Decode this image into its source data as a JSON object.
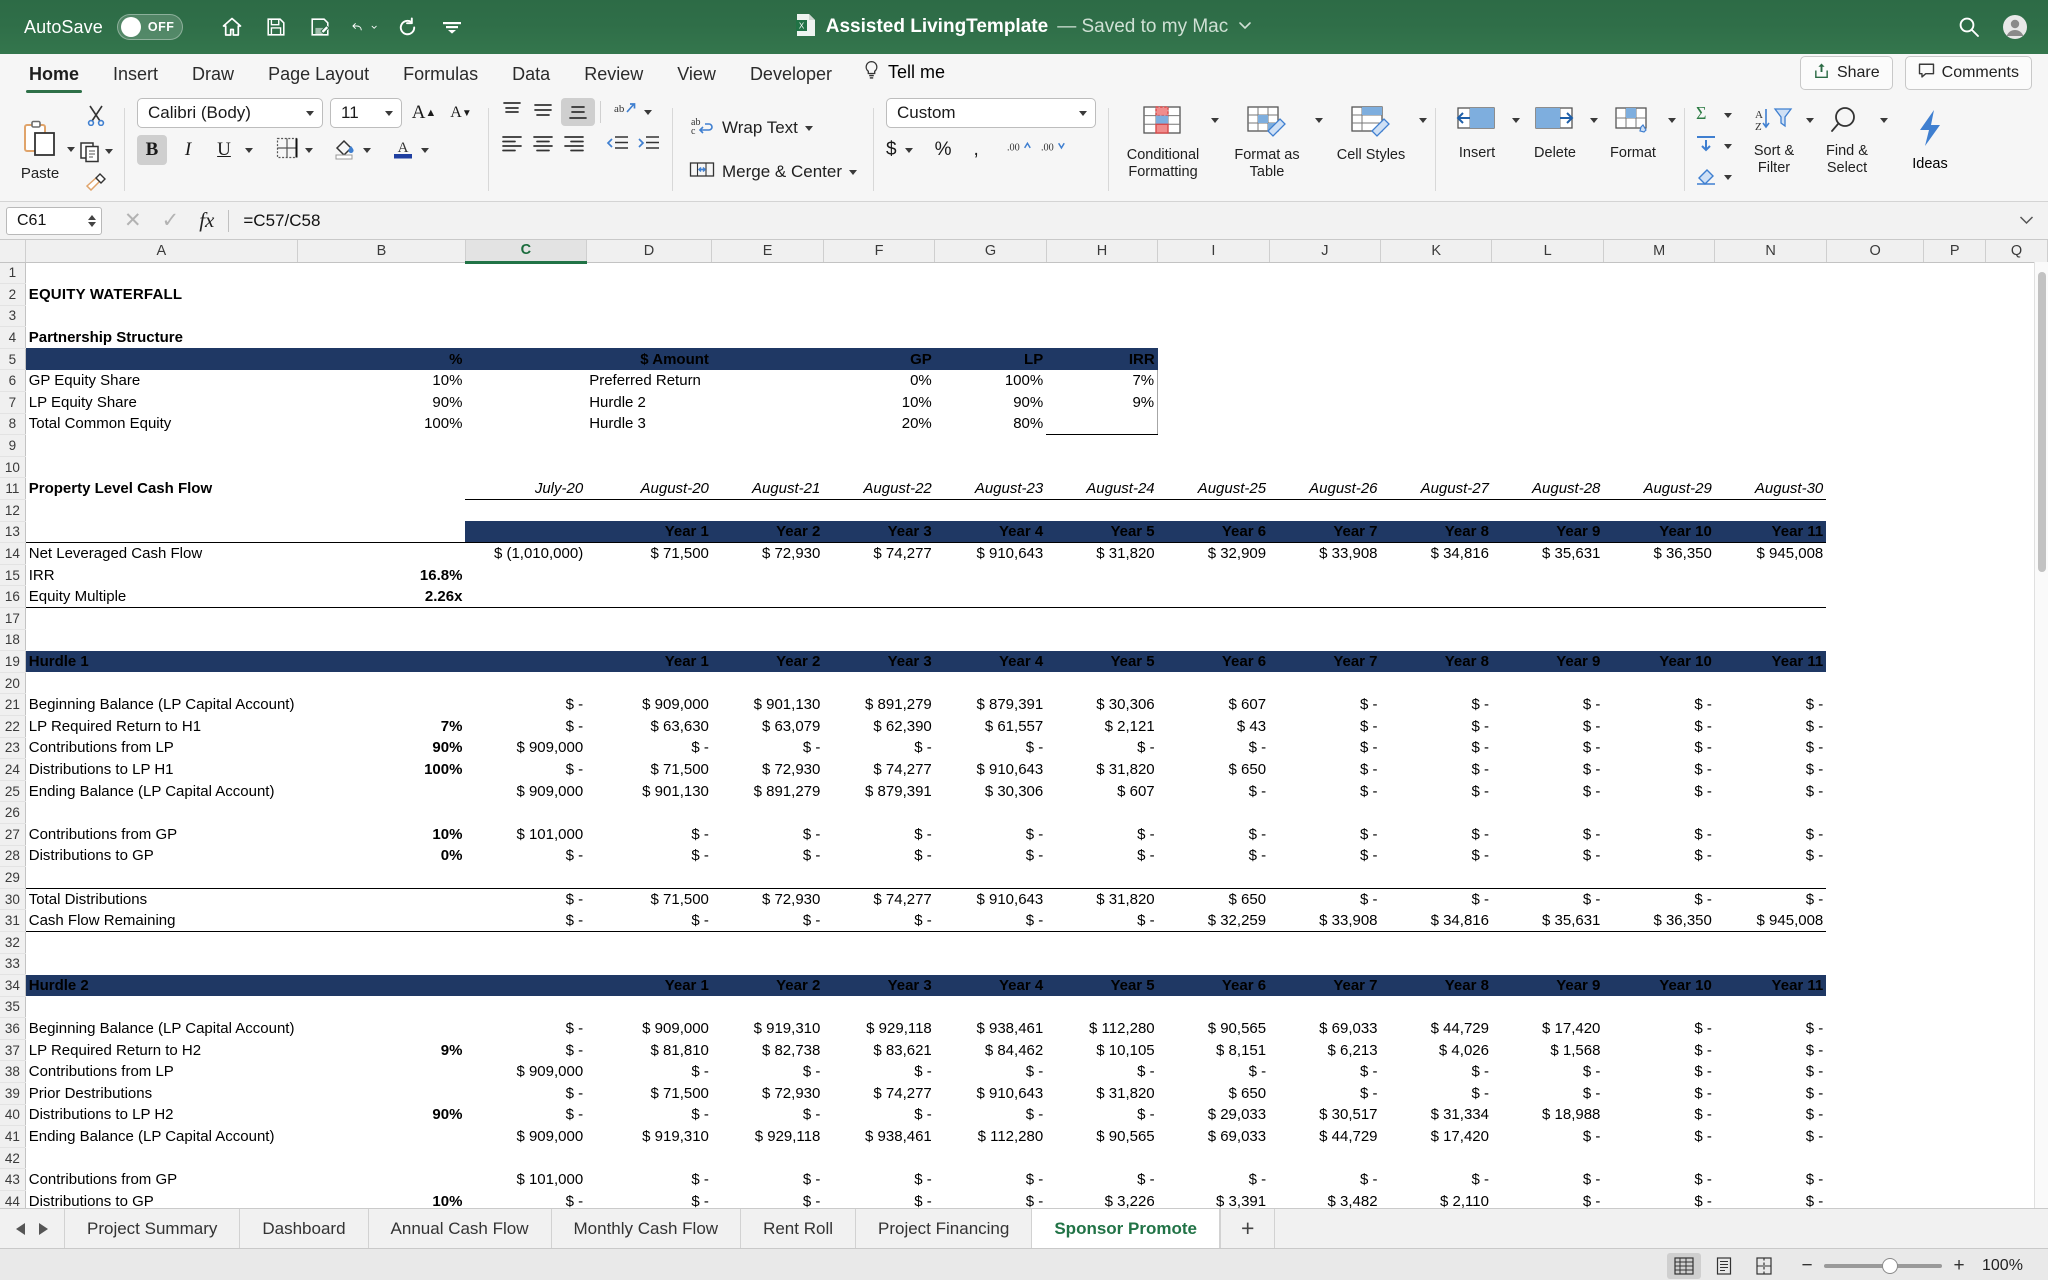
{
  "titlebar": {
    "autosave_label": "AutoSave",
    "autosave_state": "OFF",
    "doc_title": "Assisted LivingTemplate",
    "doc_status": "— Saved to my Mac",
    "icons": [
      "home-icon",
      "save-icon",
      "save-edit-icon",
      "undo-icon",
      "redo-icon",
      "customize-toolbar-icon",
      "search-icon",
      "account-icon"
    ]
  },
  "ribbon_tabs": {
    "tabs": [
      "Home",
      "Insert",
      "Draw",
      "Page Layout",
      "Formulas",
      "Data",
      "Review",
      "View",
      "Developer"
    ],
    "active": "Home",
    "tell_me": "Tell me",
    "share": "Share",
    "comments": "Comments"
  },
  "ribbon": {
    "paste_label": "Paste",
    "font_name": "Calibri (Body)",
    "font_size": "11",
    "number_format": "Custom",
    "wrap_text": "Wrap Text",
    "merge_center": "Merge & Center",
    "conditional_formatting": "Conditional Formatting",
    "format_as_table": "Format as Table",
    "cell_styles": "Cell Styles",
    "insert": "Insert",
    "delete": "Delete",
    "format": "Format",
    "sort_filter": "Sort & Filter",
    "find_select": "Find & Select",
    "ideas": "Ideas"
  },
  "formula_bar": {
    "name_box": "C61",
    "formula": "=C57/C58"
  },
  "grid": {
    "column_headers": [
      "A",
      "B",
      "C",
      "D",
      "E",
      "F",
      "G",
      "H",
      "I",
      "J",
      "K",
      "L",
      "M",
      "N",
      "O",
      "P",
      "Q"
    ],
    "selected_column": "C",
    "first_row": 1,
    "last_row": 44
  },
  "sheet_tabs": {
    "tabs": [
      "Project Summary",
      "Dashboard",
      "Annual Cash Flow",
      "Monthly Cash Flow",
      "Rent Roll",
      "Project Financing",
      "Sponsor Promote"
    ],
    "active": "Sponsor Promote",
    "add_label": "+"
  },
  "statusbar": {
    "zoom": "100%",
    "views": [
      "normal-view",
      "page-layout-view",
      "page-break-view"
    ]
  },
  "sheet": {
    "title": "EQUITY WATERFALL",
    "partnership": {
      "heading": "Partnership Structure",
      "headers": [
        "",
        "%",
        "$ Amount",
        "",
        "GP",
        "LP",
        "IRR"
      ],
      "rows": [
        {
          "label": "GP Equity Share",
          "pct": "10%",
          "amount": "",
          "name": "Preferred Return",
          "gp": "0%",
          "lp": "100%",
          "irr": "7%"
        },
        {
          "label": "LP Equity Share",
          "pct": "90%",
          "amount": "",
          "name": "Hurdle 2",
          "gp": "10%",
          "lp": "90%",
          "irr": "9%"
        },
        {
          "label": "Total Common Equity",
          "pct": "100%",
          "amount": "",
          "name": "Hurdle 3",
          "gp": "20%",
          "lp": "80%",
          "irr": ""
        }
      ]
    },
    "property_cf": {
      "heading": "Property Level Cash Flow",
      "dates": [
        "July-20",
        "August-20",
        "August-21",
        "August-22",
        "August-23",
        "August-24",
        "August-25",
        "August-26",
        "August-27",
        "August-28",
        "August-29",
        "August-30"
      ],
      "year_headers": [
        "Year 1",
        "Year 2",
        "Year 3",
        "Year 4",
        "Year 5",
        "Year 6",
        "Year 7",
        "Year 8",
        "Year 9",
        "Year 10",
        "Year 11"
      ],
      "net_leveraged_label": "Net Leveraged Cash Flow",
      "net_leveraged_initial": "(1,010,000)",
      "net_leveraged": [
        "71,500",
        "72,930",
        "74,277",
        "910,643",
        "31,820",
        "32,909",
        "33,908",
        "34,816",
        "35,631",
        "36,350",
        "945,008"
      ],
      "irr_label": "IRR",
      "irr_value": "16.8%",
      "equity_multiple_label": "Equity Multiple",
      "equity_multiple_value": "2.26x"
    },
    "hurdle1": {
      "title": "Hurdle 1",
      "year_headers": [
        "Year 1",
        "Year 2",
        "Year 3",
        "Year 4",
        "Year 5",
        "Year 6",
        "Year 7",
        "Year 8",
        "Year 9",
        "Year 10",
        "Year 11"
      ],
      "rows": [
        {
          "label": "Beginning Balance (LP Capital Account)",
          "pct": "",
          "initial": "-",
          "values": [
            "909,000",
            "901,130",
            "891,279",
            "879,391",
            "30,306",
            "607",
            "-",
            "-",
            "-",
            "-",
            "-"
          ]
        },
        {
          "label": "LP Required Return to H1",
          "pct": "7%",
          "initial": "-",
          "values": [
            "63,630",
            "63,079",
            "62,390",
            "61,557",
            "2,121",
            "43",
            "-",
            "-",
            "-",
            "-",
            "-"
          ]
        },
        {
          "label": "Contributions from LP",
          "pct": "90%",
          "initial": "909,000",
          "values": [
            "-",
            "-",
            "-",
            "-",
            "-",
            "-",
            "-",
            "-",
            "-",
            "-",
            "-"
          ]
        },
        {
          "label": "Distributions to LP H1",
          "pct": "100%",
          "initial": "-",
          "values": [
            "71,500",
            "72,930",
            "74,277",
            "910,643",
            "31,820",
            "650",
            "-",
            "-",
            "-",
            "-",
            "-"
          ]
        },
        {
          "label": "Ending Balance (LP Capital Account)",
          "pct": "",
          "initial": "909,000",
          "values": [
            "901,130",
            "891,279",
            "879,391",
            "30,306",
            "607",
            "-",
            "-",
            "-",
            "-",
            "-",
            "-"
          ]
        }
      ],
      "gp_rows": [
        {
          "label": "Contributions from GP",
          "pct": "10%",
          "initial": "101,000",
          "values": [
            "-",
            "-",
            "-",
            "-",
            "-",
            "-",
            "-",
            "-",
            "-",
            "-",
            "-"
          ]
        },
        {
          "label": "Distributions to GP",
          "pct": "0%",
          "initial": "-",
          "values": [
            "-",
            "-",
            "-",
            "-",
            "-",
            "-",
            "-",
            "-",
            "-",
            "-",
            "-"
          ]
        }
      ],
      "total_row": {
        "label": "Total Distributions",
        "pct": "",
        "initial": "-",
        "values": [
          "71,500",
          "72,930",
          "74,277",
          "910,643",
          "31,820",
          "650",
          "-",
          "-",
          "-",
          "-",
          "-"
        ]
      },
      "remain_row": {
        "label": "Cash Flow Remaining",
        "pct": "",
        "initial": "-",
        "values": [
          "-",
          "-",
          "-",
          "-",
          "-",
          "32,259",
          "33,908",
          "34,816",
          "35,631",
          "36,350",
          "945,008"
        ]
      }
    },
    "hurdle2": {
      "title": "Hurdle 2",
      "year_headers": [
        "Year 1",
        "Year 2",
        "Year 3",
        "Year 4",
        "Year 5",
        "Year 6",
        "Year 7",
        "Year 8",
        "Year 9",
        "Year 10",
        "Year 11"
      ],
      "rows": [
        {
          "label": "Beginning Balance (LP Capital Account)",
          "pct": "",
          "initial": "-",
          "values": [
            "909,000",
            "919,310",
            "929,118",
            "938,461",
            "112,280",
            "90,565",
            "69,033",
            "44,729",
            "17,420",
            "-",
            "-"
          ]
        },
        {
          "label": "LP Required Return to H2",
          "pct": "9%",
          "initial": "-",
          "values": [
            "81,810",
            "82,738",
            "83,621",
            "84,462",
            "10,105",
            "8,151",
            "6,213",
            "4,026",
            "1,568",
            "-",
            "-"
          ]
        },
        {
          "label": "Contributions from LP",
          "pct": "",
          "initial": "909,000",
          "values": [
            "-",
            "-",
            "-",
            "-",
            "-",
            "-",
            "-",
            "-",
            "-",
            "-",
            "-"
          ]
        },
        {
          "label": "Prior Destributions",
          "pct": "",
          "initial": "-",
          "values": [
            "71,500",
            "72,930",
            "74,277",
            "910,643",
            "31,820",
            "650",
            "-",
            "-",
            "-",
            "-",
            "-"
          ]
        },
        {
          "label": "Distributions to LP H2",
          "pct": "90%",
          "initial": "-",
          "values": [
            "-",
            "-",
            "-",
            "-",
            "-",
            "29,033",
            "30,517",
            "31,334",
            "18,988",
            "-",
            "-"
          ]
        },
        {
          "label": "Ending Balance (LP Capital Account)",
          "pct": "",
          "initial": "909,000",
          "values": [
            "919,310",
            "929,118",
            "938,461",
            "112,280",
            "90,565",
            "69,033",
            "44,729",
            "17,420",
            "-",
            "-",
            "-"
          ]
        }
      ],
      "gp_rows": [
        {
          "label": "Contributions from GP",
          "pct": "",
          "initial": "101,000",
          "values": [
            "-",
            "-",
            "-",
            "-",
            "-",
            "-",
            "-",
            "-",
            "-",
            "-",
            "-"
          ]
        },
        {
          "label": "Distributions to GP",
          "pct": "10%",
          "initial": "-",
          "values": [
            "-",
            "-",
            "-",
            "-",
            "3,226",
            "3,391",
            "3,482",
            "2,110",
            "-",
            "-",
            "-"
          ]
        }
      ]
    }
  }
}
